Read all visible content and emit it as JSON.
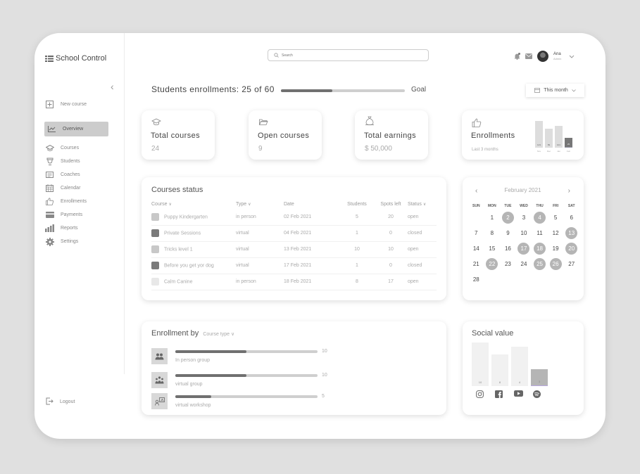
{
  "app": {
    "title": "School Control"
  },
  "sidebar": {
    "new_course": "New course",
    "items": [
      {
        "label": "Overview",
        "icon": "chart-line-icon",
        "active": true
      },
      {
        "label": "Courses",
        "icon": "graduation-cap-icon"
      },
      {
        "label": "Students",
        "icon": "student-icon"
      },
      {
        "label": "Coaches",
        "icon": "id-card-icon"
      },
      {
        "label": "Calendar",
        "icon": "calendar-icon"
      },
      {
        "label": "Enrollments",
        "icon": "thumbs-up-icon"
      },
      {
        "label": "Payments",
        "icon": "credit-card-icon"
      },
      {
        "label": "Reports",
        "icon": "bar-chart-icon"
      },
      {
        "label": "Settings",
        "icon": "gear-icon"
      }
    ],
    "logout": "Logout"
  },
  "header": {
    "search_placeholder": "Search",
    "user": {
      "name": "Ana",
      "role": "Admin"
    }
  },
  "enrollments_goal": {
    "label": "Students enrollments: 25 of 60",
    "current": 25,
    "target": 60,
    "goal_label": "Goal",
    "period": "This month"
  },
  "stats": {
    "total_courses": {
      "title": "Total courses",
      "value": "24"
    },
    "open_courses": {
      "title": "Open courses",
      "value": "9"
    },
    "total_earnings": {
      "title": "Total earnings",
      "value": "$ 50,000"
    },
    "enrollments": {
      "title": "Enrollments",
      "subtitle": "Last 3 months",
      "bars": [
        {
          "month": "Nov",
          "value": 123
        },
        {
          "month": "Dec",
          "value": 89
        },
        {
          "month": "Jan",
          "value": 101
        },
        {
          "month": "Feb",
          "value": 25
        }
      ]
    }
  },
  "courses_status": {
    "title": "Courses status",
    "columns": [
      "Course",
      "Type",
      "Date",
      "Students",
      "Spots left",
      "Status"
    ],
    "rows": [
      {
        "course": "Puppy Kindergarten",
        "type": "in person",
        "date": "02 Feb 2021",
        "students": "5",
        "spots": "20",
        "status": "open",
        "color": "#c8c8c8"
      },
      {
        "course": "Private Sessions",
        "type": "virtual",
        "date": "04 Feb 2021",
        "students": "1",
        "spots": "0",
        "status": "closed",
        "color": "#7a7a7a"
      },
      {
        "course": "Tricks level 1",
        "type": "virtual",
        "date": "13 Feb 2021",
        "students": "10",
        "spots": "10",
        "status": "open",
        "color": "#c8c8c8"
      },
      {
        "course": "Before you get yor dog",
        "type": "virtual",
        "date": "17 Feb 2021",
        "students": "1",
        "spots": "0",
        "status": "closed",
        "color": "#7a7a7a"
      },
      {
        "course": "Calm Canine",
        "type": "in person",
        "date": "18 Feb 2021",
        "students": "8",
        "spots": "17",
        "status": "open",
        "color": "#e8e8e8"
      }
    ]
  },
  "calendar": {
    "month": "February 2021",
    "weekdays": [
      "SUN",
      "MON",
      "TUE",
      "WED",
      "THU",
      "FRI",
      "SAT"
    ],
    "start_offset": 1,
    "days": 28,
    "highlighted": [
      2,
      4,
      13,
      17,
      18,
      20,
      22,
      25,
      26
    ]
  },
  "enrollment_by": {
    "title": "Enrollment by",
    "selector": "Course type",
    "max": 20,
    "rows": [
      {
        "label": "In person group",
        "value": 10,
        "icon": "group-icon"
      },
      {
        "label": "virtual group",
        "value": 10,
        "icon": "virtual-group-icon"
      },
      {
        "label": "virtual workshop",
        "value": 5,
        "icon": "workshop-icon"
      }
    ]
  },
  "social_value": {
    "title": "Social value",
    "bars": [
      {
        "network": "instagram",
        "value": 10,
        "icon": "instagram-icon"
      },
      {
        "network": "facebook",
        "value": 8,
        "icon": "facebook-icon"
      },
      {
        "network": "youtube",
        "value": 4,
        "icon": "youtube-icon"
      },
      {
        "network": "spotify",
        "value": 3,
        "icon": "spotify-icon"
      }
    ]
  }
}
